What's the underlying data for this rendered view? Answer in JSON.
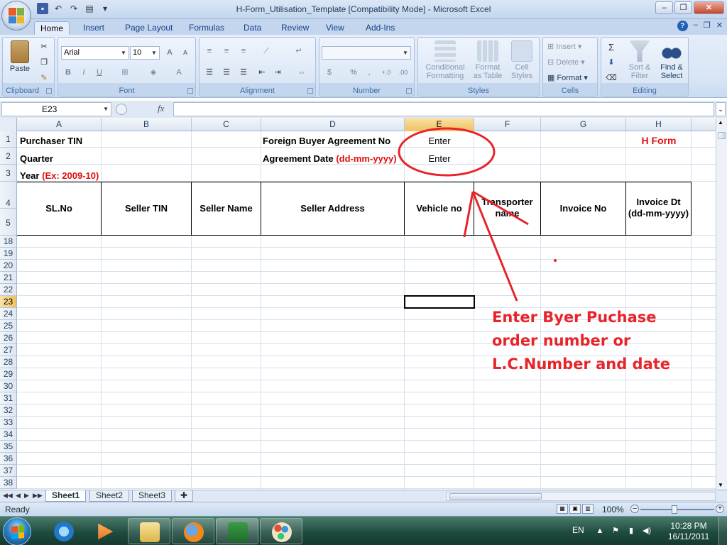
{
  "window": {
    "title": "H-Form_Utilisation_Template  [Compatibility Mode] - Microsoft Excel"
  },
  "ribbon_tabs": [
    "Home",
    "Insert",
    "Page Layout",
    "Formulas",
    "Data",
    "Review",
    "View",
    "Add-Ins"
  ],
  "ribbon": {
    "clipboard": {
      "group": "Clipboard",
      "paste": "Paste"
    },
    "font": {
      "group": "Font",
      "name": "Arial",
      "size": "10",
      "bold": "B",
      "italic": "I",
      "underline": "U",
      "grow": "A",
      "shrink": "A",
      "color": "A"
    },
    "alignment": {
      "group": "Alignment"
    },
    "number": {
      "group": "Number",
      "currency": "$",
      "percent": "%",
      "comma": ",",
      "inc_decimal": "+.0",
      "dec_decimal": ".00"
    },
    "styles": {
      "group": "Styles",
      "conditional_1": "Conditional",
      "conditional_2": "Formatting",
      "format_table_1": "Format",
      "format_table_2": "as Table",
      "cell_styles_1": "Cell",
      "cell_styles_2": "Styles"
    },
    "cells": {
      "group": "Cells",
      "insert": "Insert",
      "delete": "Delete",
      "format": "Format"
    },
    "editing": {
      "group": "Editing",
      "sigma": "Σ",
      "sort_1": "Sort &",
      "sort_2": "Filter",
      "find_1": "Find &",
      "find_2": "Select"
    }
  },
  "formula_bar": {
    "name_box": "E23",
    "fx": "fx",
    "content": ""
  },
  "columns": [
    "A",
    "B",
    "C",
    "D",
    "E",
    "F",
    "G",
    "H"
  ],
  "selected_column": "E",
  "rows": [
    "1",
    "2",
    "3",
    "4",
    "5",
    "18",
    "19",
    "20",
    "21",
    "22",
    "23",
    "24",
    "25",
    "26",
    "27",
    "28",
    "29",
    "30",
    "31",
    "32",
    "33",
    "34",
    "35",
    "36",
    "37",
    "38"
  ],
  "selected_row": "23",
  "cells": {
    "purchaser_tin": "Purchaser TIN",
    "quarter": "Quarter",
    "year": "Year",
    "year_hint": "(Ex: 2009-10)",
    "foreign_buyer": "Foreign Buyer Agreement No",
    "agreement_date": "Agreement Date",
    "agreement_date_hint": "(dd-mm-yyyy)",
    "enter_1": "Enter",
    "enter_2": "Enter",
    "h_form": "H Form"
  },
  "table_headers": {
    "sl_no": "SL.No",
    "seller_tin": "Seller TIN",
    "seller_name": "Seller Name",
    "seller_address": "Seller Address",
    "vehicle_no": "Vehicle no",
    "transporter_1": "Transporter",
    "transporter_2": "name",
    "invoice_no": "Invoice No",
    "invoice_dt_1": "Invoice Dt",
    "invoice_dt_2": "(dd-mm-yyyy)"
  },
  "annotation": {
    "line1": "Enter Byer Puchase",
    "line2": "order number or",
    "line3": "L.C.Number and date",
    "color": "#e8242a"
  },
  "sheets": [
    "Sheet1",
    "Sheet2",
    "Sheet3"
  ],
  "active_sheet": "Sheet1",
  "status": {
    "ready": "Ready",
    "zoom": "100%"
  },
  "taskbar": {
    "apps": [
      "internet-explorer-icon",
      "media-player-icon",
      "file-explorer-icon",
      "firefox-icon",
      "excel-icon",
      "paint-icon"
    ],
    "lang": "EN",
    "time": "10:28 PM",
    "date": "16/11/2011"
  }
}
